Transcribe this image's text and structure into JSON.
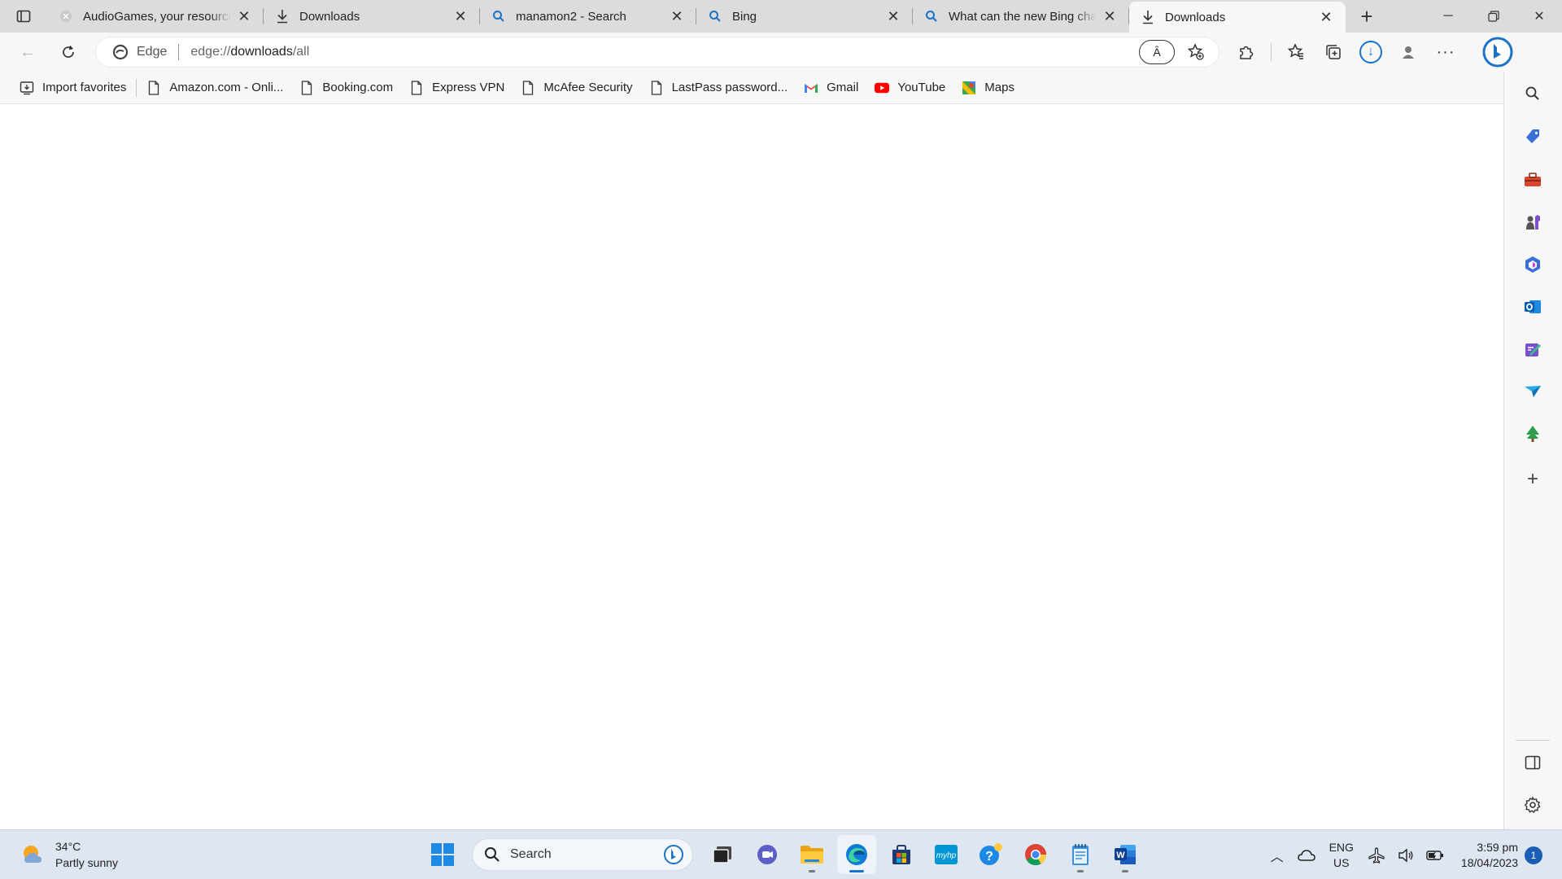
{
  "tabs": [
    {
      "label": "AudioGames, your resource",
      "icon": "audiogames-icon"
    },
    {
      "label": "Downloads",
      "icon": "download-icon"
    },
    {
      "label": "manamon2 - Search",
      "icon": "search-icon"
    },
    {
      "label": "Bing",
      "icon": "search-icon"
    },
    {
      "label": "What can the new Bing chat",
      "icon": "search-icon"
    },
    {
      "label": "Downloads",
      "icon": "download-icon",
      "active": true
    }
  ],
  "address": {
    "edge_label": "Edge",
    "url_prefix": "edge://",
    "url_host": "downloads",
    "url_path": "/all",
    "read_aloud": "Ȃ"
  },
  "favorites": [
    {
      "label": "Import favorites",
      "icon": "import-favorites-icon"
    },
    {
      "label": "Amazon.com - Onli...",
      "icon": "page-icon"
    },
    {
      "label": "Booking.com",
      "icon": "page-icon"
    },
    {
      "label": "Express VPN",
      "icon": "page-icon"
    },
    {
      "label": "McAfee Security",
      "icon": "page-icon"
    },
    {
      "label": "LastPass password...",
      "icon": "page-icon"
    },
    {
      "label": "Gmail",
      "icon": "gmail-icon"
    },
    {
      "label": "YouTube",
      "icon": "youtube-icon"
    },
    {
      "label": "Maps",
      "icon": "maps-icon"
    }
  ],
  "taskbar": {
    "weather_temp": "34°C",
    "weather_desc": "Partly sunny",
    "search_label": "Search",
    "lang_top": "ENG",
    "lang_bottom": "US",
    "time": "3:59 pm",
    "date": "18/04/2023",
    "notification_count": "1"
  },
  "colors": {
    "accent": "#1a73c6",
    "tab_bg": "#dcdcdc",
    "toolbar_bg": "#f7f7f7",
    "taskbar_bg": "#dde6f1"
  }
}
